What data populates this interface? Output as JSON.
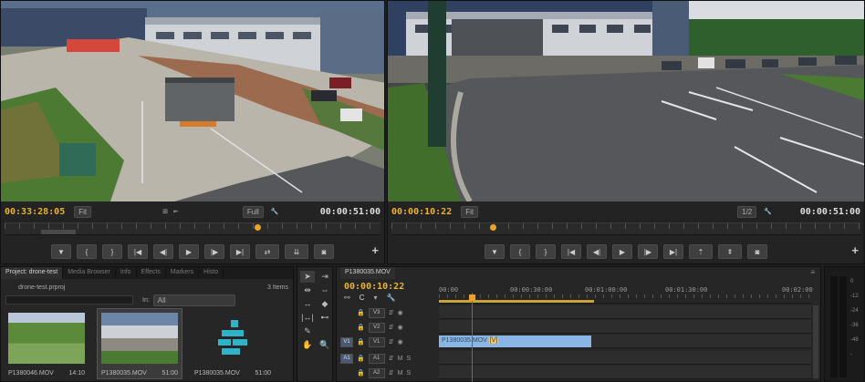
{
  "source_monitor": {
    "timecode_current": "00:33:28:05",
    "fit_label": "Fit",
    "quality_label": "Full",
    "timecode_duration": "00:00:51:00"
  },
  "program_monitor": {
    "timecode_current": "00:00:10:22",
    "fit_label": "Fit",
    "quality_label": "1/2",
    "timecode_duration": "00:00:51:00"
  },
  "project_panel": {
    "tabs": [
      "Project: drone-test",
      "Media Browser",
      "Info",
      "Effects",
      "Markers",
      "Histo"
    ],
    "project_file": "drone-test.prproj",
    "item_count": "3 Items",
    "in_label": "In:",
    "in_value": "All",
    "items": [
      {
        "name": "P1380046.MOV",
        "duration": "14:10"
      },
      {
        "name": "P1380035.MOV",
        "duration": "51:00"
      },
      {
        "name": "P1380035.MOV",
        "duration": "51:00"
      }
    ]
  },
  "timeline": {
    "sequence_tab": "P1380035.MOV",
    "timecode": "00:00:10:22",
    "ruler_labels": [
      "00:00",
      "00:00:30:00",
      "00:01:00:00",
      "00:01:30:00",
      "00:02:00"
    ],
    "tracks": [
      {
        "label": "V3",
        "type": "video"
      },
      {
        "label": "V2",
        "type": "video"
      },
      {
        "label": "V1",
        "type": "video",
        "source": "V1"
      },
      {
        "label": "A1",
        "type": "audio",
        "source": "A1"
      },
      {
        "label": "A2",
        "type": "audio"
      }
    ],
    "clip_name": "P1380035.MOV",
    "clip_fx": "[V]"
  },
  "audio_meter": {
    "scale": [
      "0",
      "-12",
      "-24",
      "-36",
      "-48",
      "-"
    ]
  },
  "colors": {
    "timecode_accent": "#e9b32c",
    "clip_video": "#8ab6e5",
    "playhead": "#d23b3b"
  }
}
